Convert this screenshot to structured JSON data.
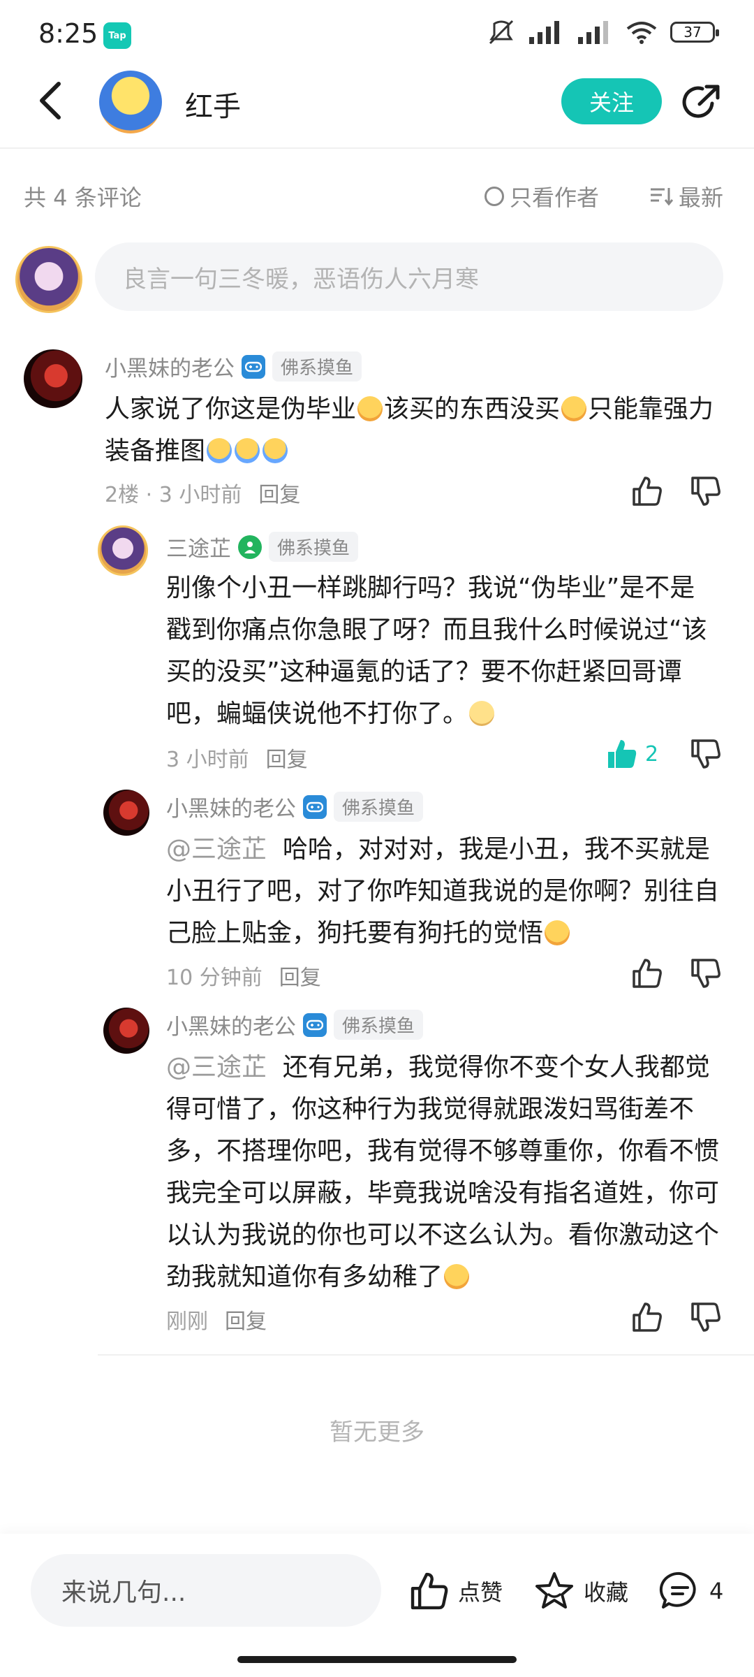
{
  "status_bar": {
    "time": "8:25",
    "app_badge": "Tap",
    "battery": "37"
  },
  "header": {
    "title": "红手",
    "follow_label": "关注"
  },
  "filter": {
    "count_text": "共 4 条评论",
    "only_author_label": "只看作者",
    "sort_label": "最新"
  },
  "composer": {
    "placeholder": "良言一句三冬暖，恶语伤人六月寒"
  },
  "comments": [
    {
      "user": "小黑妹的老公",
      "tag": "佛系摸鱼",
      "text_parts": [
        "人家说了你这是伪毕业",
        "该买的东西没买",
        "只能靠强力装备推图"
      ],
      "floor": "2楼",
      "time": "3 小时前",
      "reply_label": "回复"
    },
    {
      "user": "三途芷",
      "tag": "佛系摸鱼",
      "text": "别像个小丑一样跳脚行吗？我说“伪毕业”是不是戳到你痛点你急眼了呀？而且我什么时候说过“该买的没买”这种逼氪的话了？要不你赶紧回哥谭吧，蝙蝠侠说他不打你了。",
      "time": "3 小时前",
      "reply_label": "回复",
      "like_count": "2"
    },
    {
      "user": "小黑妹的老公",
      "tag": "佛系摸鱼",
      "mention": "@三途芷",
      "text": "哈哈，对对对，我是小丑，我不买就是小丑行了吧，对了你咋知道我说的是你啊？别往自己脸上贴金，狗托要有狗托的觉悟",
      "time": "10 分钟前",
      "reply_label": "回复"
    },
    {
      "user": "小黑妹的老公",
      "tag": "佛系摸鱼",
      "mention": "@三途芷",
      "text": "还有兄弟，我觉得你不变个女人我都觉得可惜了，你这种行为我觉得就跟泼妇骂街差不多，不搭理你吧，我有觉得不够尊重你，你看不惯我完全可以屏蔽，毕竟我说啥没有指名道姓，你可以认为我说的你也可以不这么认为。看你激动这个劲我就知道你有多幼稚了",
      "time": "刚刚",
      "reply_label": "回复"
    }
  ],
  "no_more": "暂无更多",
  "bottom_bar": {
    "input_placeholder": "来说几句...",
    "like_label": "点赞",
    "favorite_label": "收藏",
    "comment_count": "4"
  },
  "colors": {
    "accent": "#15c5b5",
    "text_primary": "#1c1c1c",
    "text_secondary": "#8a8a8a"
  }
}
